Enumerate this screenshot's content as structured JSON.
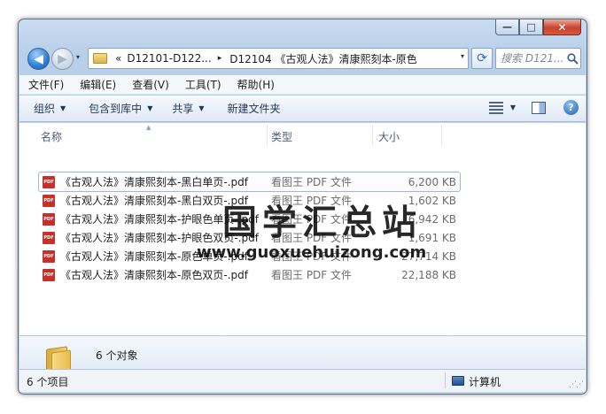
{
  "window": {
    "controls": {
      "minimize": "—",
      "maximize": "□",
      "close": "✕"
    }
  },
  "nav": {
    "back_arrow": "◀",
    "forward_arrow": "▶",
    "recent_dropdown": "▾",
    "breadcrumb_overflow": "«",
    "breadcrumbs": [
      "D12101-D122...",
      "D12104 《古观人法》清康熙刻本-原色"
    ],
    "breadcrumb_separator": "▸",
    "address_dropdown": "▾",
    "refresh_glyph": "⟳",
    "search_placeholder": "搜索 D121...",
    "search_icon": "magnifier-icon"
  },
  "menu": {
    "items": [
      "文件(F)",
      "编辑(E)",
      "查看(V)",
      "工具(T)",
      "帮助(H)"
    ]
  },
  "toolbar": {
    "organize": "组织",
    "include_in_library": "包含到库中",
    "share": "共享",
    "new_folder": "新建文件夹",
    "dropdown_glyph": "▼",
    "help_glyph": "?"
  },
  "columns": {
    "name": "名称",
    "type": "类型",
    "size": "大小",
    "sort_glyph": "▲"
  },
  "files": [
    {
      "name": "《古观人法》清康熙刻本-黑白单页-.pdf",
      "type": "看图王 PDF 文件",
      "size": "6,200 KB",
      "icon_label": "PDF"
    },
    {
      "name": "《古观人法》清康熙刻本-黑白双页-.pdf",
      "type": "看图王 PDF 文件",
      "size": "1,602 KB",
      "icon_label": "PDF"
    },
    {
      "name": "《古观人法》清康熙刻本-护眼色单页-.pdf",
      "type": "看图王 PDF 文件",
      "size": "6,942 KB",
      "icon_label": "PDF"
    },
    {
      "name": "《古观人法》清康熙刻本-护眼色双页-.pdf",
      "type": "看图王 PDF 文件",
      "size": "1,691 KB",
      "icon_label": "PDF"
    },
    {
      "name": "《古观人法》清康熙刻本-原色单页-.pdf",
      "type": "看图王 PDF 文件",
      "size": "27,714 KB",
      "icon_label": "PDF"
    },
    {
      "name": "《古观人法》清康熙刻本-原色双页-.pdf",
      "type": "看图王 PDF 文件",
      "size": "22,188 KB",
      "icon_label": "PDF"
    }
  ],
  "watermark": {
    "text": "国学汇总站",
    "url": "www.guoxuehuizong.com"
  },
  "details": {
    "object_count": "6 个对象"
  },
  "status": {
    "items": "6 个项目",
    "location": "计算机",
    "grip": "⋰⋰"
  }
}
